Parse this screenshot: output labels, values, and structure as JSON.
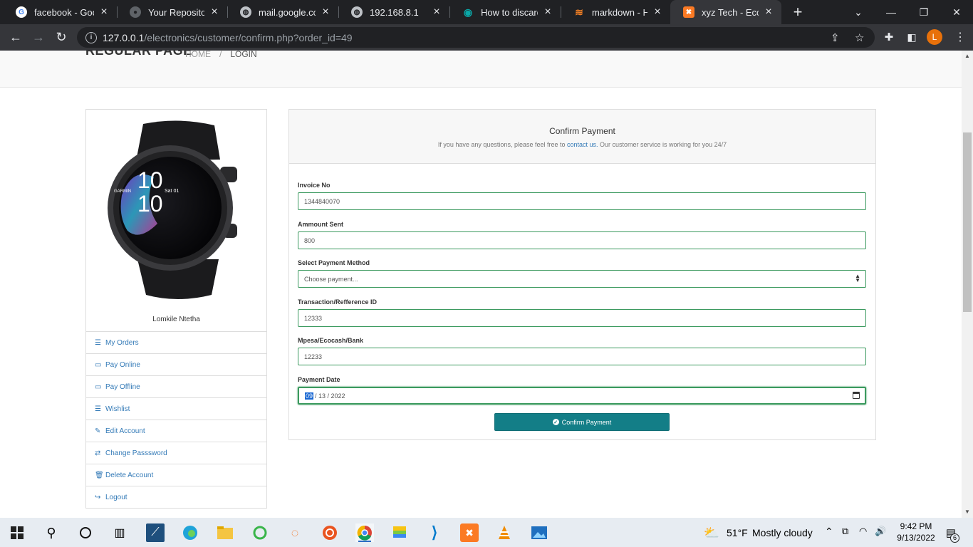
{
  "browser": {
    "tabs": [
      {
        "title": "facebook - Goog",
        "icon": "google-icon",
        "color": "#ffffff"
      },
      {
        "title": "Your Repositories",
        "icon": "github-icon",
        "color": "#bdc1c6"
      },
      {
        "title": "mail.google.com",
        "icon": "globe-icon",
        "color": "#bdc1c6"
      },
      {
        "title": "192.168.8.1",
        "icon": "globe-icon",
        "color": "#bdc1c6"
      },
      {
        "title": "How to discard y",
        "icon": "eye-icon",
        "color": "#0aa8a8"
      },
      {
        "title": "markdown - How",
        "icon": "stackoverflow-icon",
        "color": "#f48024"
      },
      {
        "title": "xyz Tech - Ecom",
        "icon": "xampp-icon",
        "color": "#fb7a24"
      }
    ],
    "url_host": "127.0.0.1",
    "url_path": "/electronics/customer/confirm.php?order_id=49",
    "profile_initial": "L"
  },
  "header": {
    "title": "REGULAR PAGE",
    "breadcrumb": [
      "HOME",
      "/",
      "LOGIN"
    ]
  },
  "sidebar": {
    "customer_name": "Lomkile Ntetha",
    "watch_time_top": "10",
    "watch_time_bottom": "10",
    "watch_brand": "GARMIN",
    "watch_date": "Sat 01",
    "items": [
      {
        "label": "My Orders",
        "icon": "list-icon",
        "glyph": "☰"
      },
      {
        "label": "Pay Online",
        "icon": "credit-card-icon",
        "glyph": "▭"
      },
      {
        "label": "Pay Offline",
        "icon": "credit-card-icon",
        "glyph": "▭"
      },
      {
        "label": "Wishlist",
        "icon": "list-icon",
        "glyph": "☰"
      },
      {
        "label": "Edit Account",
        "icon": "edit-icon",
        "glyph": "✎"
      },
      {
        "label": "Change Passsword",
        "icon": "exchange-icon",
        "glyph": "⇄"
      },
      {
        "label": "Delete Account",
        "icon": "trash-icon",
        "glyph": "🗑"
      },
      {
        "label": "Logout",
        "icon": "sign-out-icon",
        "glyph": "↪"
      }
    ]
  },
  "panel": {
    "title": "Confirm Payment",
    "subtitle_before": "If you have any questions, please feel free to ",
    "subtitle_link": "contact us.",
    "subtitle_after": " Our customer service is working for you 24/7"
  },
  "form": {
    "invoice_label": "Invoice No",
    "invoice_value": "1344840070",
    "amount_label": "Ammount Sent",
    "amount_value": "800",
    "method_label": "Select Payment Method",
    "method_value": "Choose payment...",
    "txn_label": "Transaction/Refference ID",
    "txn_value": "12333",
    "bank_label": "Mpesa/Ecocash/Bank",
    "bank_value": "12233",
    "date_label": "Payment Date",
    "date_mm": "09",
    "date_rest": "/ 13 / 2022",
    "submit_label": "Confirm Payment"
  },
  "taskbar": {
    "weather_temp": "51°F",
    "weather_desc": "Mostly cloudy",
    "time": "9:42 PM",
    "date": "9/13/2022",
    "notif_count": "6"
  }
}
